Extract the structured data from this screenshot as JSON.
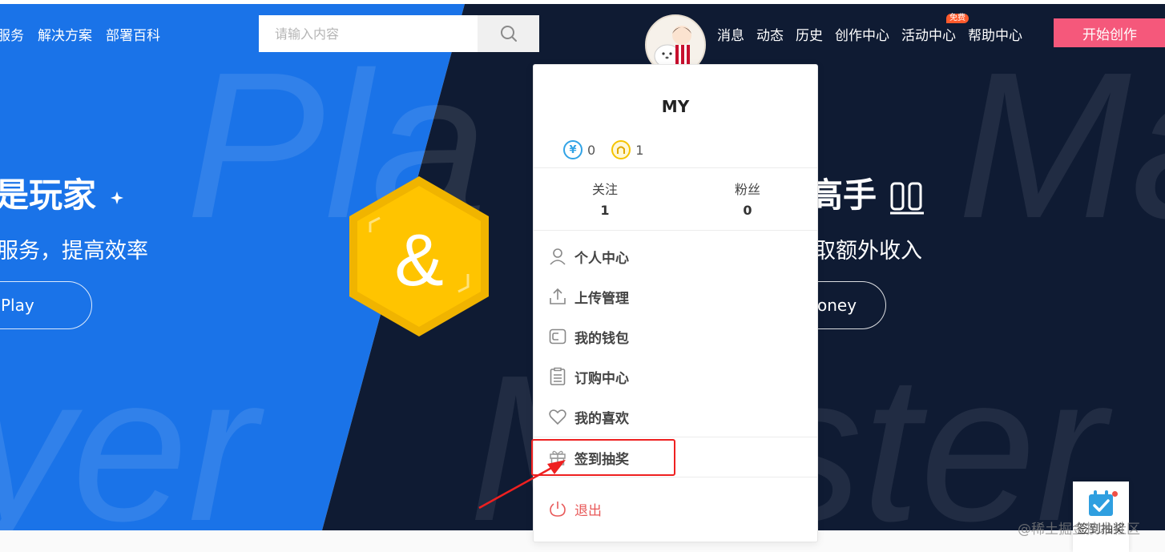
{
  "colors": {
    "blue_bg": "#1a73e8",
    "dark_bg": "#0f1b33",
    "brand_pink": "#f5587b",
    "emblem_yellow": "#ffc400",
    "highlight_red": "#ee2020",
    "logout_red": "#e85a5a"
  },
  "nav": {
    "left_items": [
      "服务",
      "解决方案",
      "部署百科"
    ],
    "search_placeholder": "请输入内容",
    "search_icon": "search-icon",
    "right_items": [
      "消息",
      "动态",
      "历史",
      "创作中心",
      "活动中心",
      "帮助中心"
    ],
    "free_badge": "免费",
    "start_button": "开始创作"
  },
  "hero": {
    "left_title": "是玩家",
    "left_subtitle": "服务，提高效率",
    "left_button": "Play",
    "right_title": "高手",
    "right_subtitle": "取额外收入",
    "right_button": "oney",
    "ghost_left_1": "Pla",
    "ghost_left_2": "yer",
    "ghost_right_1": "Ma",
    "ghost_right_2": "Master",
    "emblem_symbol": "&"
  },
  "user_menu": {
    "username": "MY",
    "yuan_icon": "¥",
    "yuan_balance": "0",
    "gold_balance": "1",
    "following_label": "关注",
    "following_count": "1",
    "followers_label": "粉丝",
    "followers_count": "0",
    "items": [
      {
        "label": "个人中心",
        "icon": "user-icon"
      },
      {
        "label": "上传管理",
        "icon": "upload-icon"
      },
      {
        "label": "我的钱包",
        "icon": "wallet-icon"
      },
      {
        "label": "订购中心",
        "icon": "clipboard-icon"
      },
      {
        "label": "我的喜欢",
        "icon": "heart-icon"
      },
      {
        "label": "签到抽奖",
        "icon": "gift-icon"
      }
    ],
    "logout": "退出"
  },
  "widget": {
    "label": "签到抽奖",
    "icon": "calendar-check-icon"
  },
  "watermark": "@稀土掘金技术社区"
}
